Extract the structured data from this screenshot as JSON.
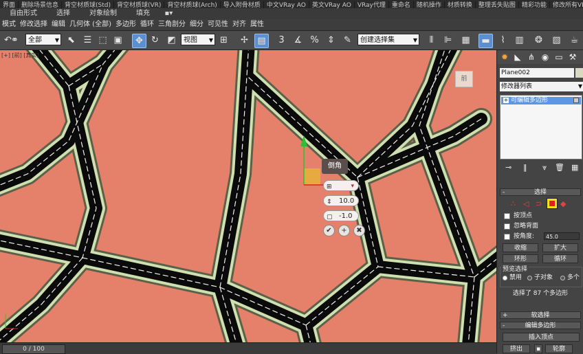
{
  "title_tabs": [
    "界面",
    "删除场景信息",
    "背空材质球(Std)",
    "背空材质球(VR)",
    "背空材质球(Arch)",
    "导入附骨材质",
    "中文VRay AO",
    "英文VRay AO",
    "VRay代理",
    "重命名",
    "随机操作",
    "材质转换",
    "整理丢失贴图",
    "精彩功能",
    "修改所有VRayMt"
  ],
  "ribbon_tabs": [
    "自由形式",
    "选择",
    "对象绘制",
    "填充"
  ],
  "menu": [
    "模式",
    "修改选择",
    "编辑",
    "几何体 (全部)",
    "多边形",
    "循环",
    "三角剖分",
    "细分",
    "可见性",
    "对齐",
    "属性"
  ],
  "toolbar": {
    "filter_value": "全部",
    "refcoord_value": "视图",
    "named_sel_value": "创建选择集"
  },
  "viewport": {
    "label": "[+] [前] [真实]",
    "viewcube_label": "前",
    "bg_color": "#e5806a",
    "road_color": "#0a0a0a",
    "border_color": "#5d6048",
    "lane_color": "#f2f2f2",
    "grass_color": "#cfe0b0"
  },
  "caddy": {
    "title": "倒角",
    "height_value": "10.0",
    "outline_value": "-1.0",
    "ok": "✔",
    "apply": "+",
    "cancel": "✖"
  },
  "statusbar": {
    "time": "0 / 100"
  },
  "panel": {
    "object_name": "Plane002",
    "modifier_list": "修改器列表",
    "stack_item": "可编辑多边形",
    "selection_title": "选择",
    "by_vertex": "按顶点",
    "ignore_backfacing": "忽略背面",
    "by_angle": "按角度:",
    "angle_value": "45.0",
    "shrink": "收缩",
    "grow": "扩大",
    "ring": "环形",
    "loop": "循环",
    "preview_title": "预览选择",
    "preview_off": "禁用",
    "preview_subobj": "子对象",
    "preview_multi": "多个",
    "selection_info": "选择了 87 个多边形",
    "soft_selection": "软选择",
    "edit_polygons": "编辑多边形",
    "insert_vertex": "插入顶点",
    "extrude": "挤出",
    "outline": "轮廓"
  }
}
